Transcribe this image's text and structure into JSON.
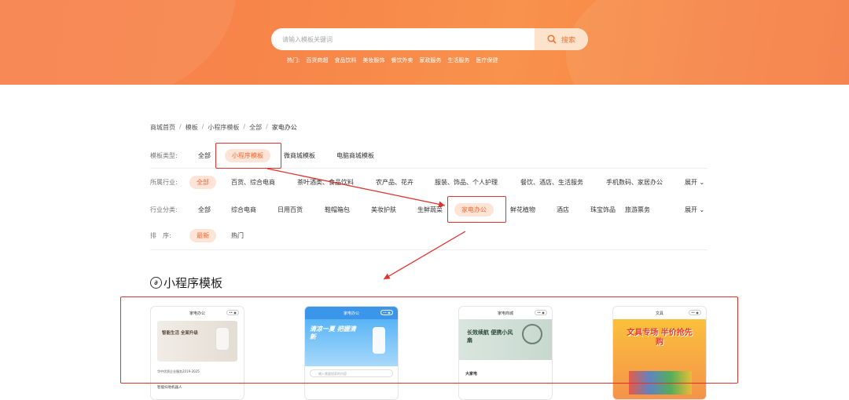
{
  "search": {
    "placeholder": "请输入模板关键词",
    "button_label": "搜索"
  },
  "hot": {
    "label": "热门:",
    "items": [
      "百货商超",
      "食品饮料",
      "美妆服饰",
      "餐饮外卖",
      "家政服务",
      "生活服务",
      "医疗保健"
    ]
  },
  "breadcrumb": [
    "商城首页",
    "模板",
    "小程序模板",
    "全部",
    "家电办公"
  ],
  "template_type": {
    "label": "模板类型:",
    "options": [
      "全部",
      "小程序模板",
      "微商城模板",
      "电脑商城模板"
    ],
    "active": "小程序模板"
  },
  "industry": {
    "label": "所属行业:",
    "options": [
      "全部",
      "百货、综合电商",
      "茶叶酒类、食品饮料",
      "农产品、花卉",
      "服装、饰品、个人护理",
      "餐饮、酒店、生活服务",
      "手机数码、家居办公"
    ],
    "active": "全部",
    "expand": "展开"
  },
  "category": {
    "label": "行业分类:",
    "options": [
      "全部",
      "综合电商",
      "日用百货",
      "鞋帽箱包",
      "美妆护肤",
      "生鲜蔬菜",
      "家电办公",
      "鲜花植物",
      "酒店",
      "珠宝饰品",
      "旅游票务"
    ],
    "active": "家电办公",
    "expand": "展开"
  },
  "sort": {
    "label": "排　序:",
    "options": [
      "最新",
      "热门"
    ],
    "active": "最新"
  },
  "section": {
    "title": "小程序模板"
  },
  "cards": [
    {
      "title": "家电办公",
      "headline": "智能生活 全面升级",
      "sub": "华中优质企业服务2019-2025",
      "footer": "智能扫地机器人"
    },
    {
      "title": "家电办公",
      "headline": "清凉一夏 把握清新",
      "sub": "输入需要搜索的内容"
    },
    {
      "title": "家电商城",
      "headline": "长效续航 便携小风扇",
      "sub": "大家电"
    },
    {
      "title": "文具",
      "headline": "文具专场 半价抢先购"
    }
  ],
  "colors": {
    "accent": "#f16a32",
    "banner": "#f7864a",
    "annotation": "#e0312d"
  }
}
